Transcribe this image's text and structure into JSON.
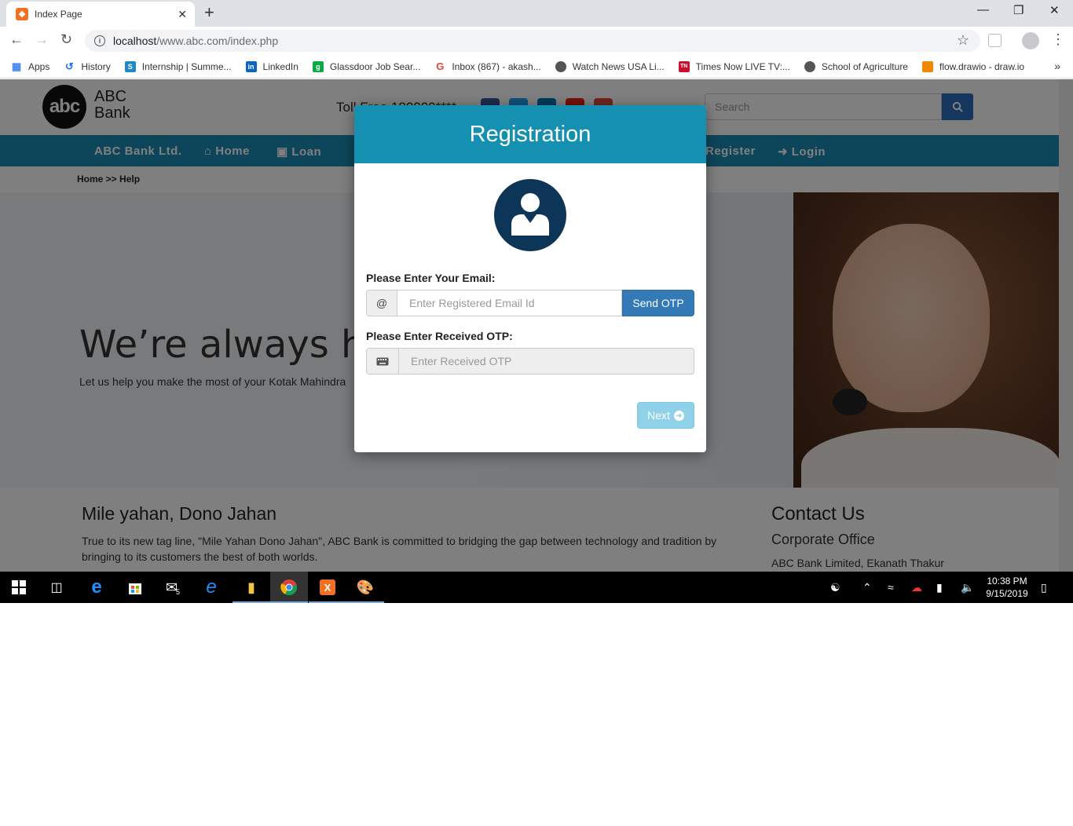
{
  "browser": {
    "tab_title": "Index Page",
    "url_host": "localhost",
    "url_path": "/www.abc.com/index.php",
    "bookmarks": [
      {
        "label": "Apps",
        "icon": "apps-grid-icon",
        "color": "#4285f4"
      },
      {
        "label": "History",
        "icon": "history-icon",
        "color": "#1a73e8"
      },
      {
        "label": "Internship | Summe...",
        "icon": "internshala-icon",
        "color": "#1e88c8"
      },
      {
        "label": "LinkedIn",
        "icon": "linkedin-icon",
        "color": "#0a66c2"
      },
      {
        "label": "Glassdoor Job Sear...",
        "icon": "glassdoor-icon",
        "color": "#0caa41"
      },
      {
        "label": "Inbox (867) - akash...",
        "icon": "google-icon",
        "color": "#ea4335"
      },
      {
        "label": "Watch News USA Li...",
        "icon": "globe-icon",
        "color": "#555555"
      },
      {
        "label": "Times Now LIVE TV:...",
        "icon": "times-now-icon",
        "color": "#c8102e"
      },
      {
        "label": "School of Agriculture",
        "icon": "globe-icon",
        "color": "#555555"
      },
      {
        "label": "flow.drawio - draw.io",
        "icon": "drawio-icon",
        "color": "#f08705"
      }
    ]
  },
  "site": {
    "logo_badge": "abc",
    "logo_line1": "ABC",
    "logo_line2": "Bank",
    "tollfree": "Toll Free 180000****",
    "search_placeholder": "Search",
    "nav": {
      "brand": "ABC Bank Ltd.",
      "home": "Home",
      "loan": "Loan",
      "register": "Register",
      "login": "Login"
    },
    "breadcrumb": "Home >> Help",
    "hero_title": "We’re always here",
    "hero_sub": "Let us help you make the most of your Kotak Mahindra",
    "about_title": "Mile yahan, Dono Jahan",
    "about_text": "True to its new tag line, \"Mile Yahan Dono Jahan\", ABC Bank is committed to bridging the gap between technology and tradition by bringing to its customers the best of both worlds.",
    "contact_title": "Contact Us",
    "contact_sub": "Corporate Office",
    "contact_text": "ABC Bank Limited, Ekanath Thakur"
  },
  "modal": {
    "title": "Registration",
    "email_label": "Please Enter Your Email:",
    "email_addon": "@",
    "email_placeholder": "Enter Registered Email Id",
    "send_otp": "Send OTP",
    "otp_label": "Please Enter Received OTP:",
    "otp_placeholder": "Enter Received OTP",
    "next": "Next"
  },
  "taskbar": {
    "mail_badge": "5",
    "time": "10:38 PM",
    "date": "9/15/2019"
  },
  "colors": {
    "nav_bar": "#1a8cb4",
    "modal_header": "#1590b1",
    "send_button": "#337ab7",
    "next_button": "#8ed1e8",
    "avatar": "#0d3557"
  }
}
